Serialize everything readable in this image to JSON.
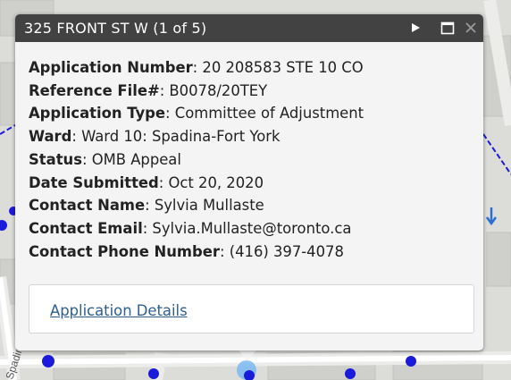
{
  "popup": {
    "title": "325 FRONT ST W (1 of 5)",
    "fields": [
      {
        "label": "Application Number",
        "value": "20 208583 STE 10 CO"
      },
      {
        "label": "Reference File#",
        "value": "B0078/20TEY"
      },
      {
        "label": "Application Type",
        "value": "Committee of Adjustment"
      },
      {
        "label": "Ward",
        "value": "Ward 10: Spadina-Fort York"
      },
      {
        "label": "Status",
        "value": "OMB Appeal"
      },
      {
        "label": "Date Submitted",
        "value": "Oct 20, 2020"
      },
      {
        "label": "Contact Name",
        "value": "Sylvia Mullaste"
      },
      {
        "label": "Contact Email",
        "value": "Sylvia.Mullaste@toronto.ca"
      },
      {
        "label": "Contact Phone Number",
        "value": "(416) 397-4078"
      }
    ],
    "details_link": "Application Details",
    "icons": [
      "play-next-icon",
      "maximize-icon",
      "close-icon"
    ]
  },
  "map": {
    "street_label": "Spadina Ave",
    "marker_color": "#1a1adb"
  }
}
